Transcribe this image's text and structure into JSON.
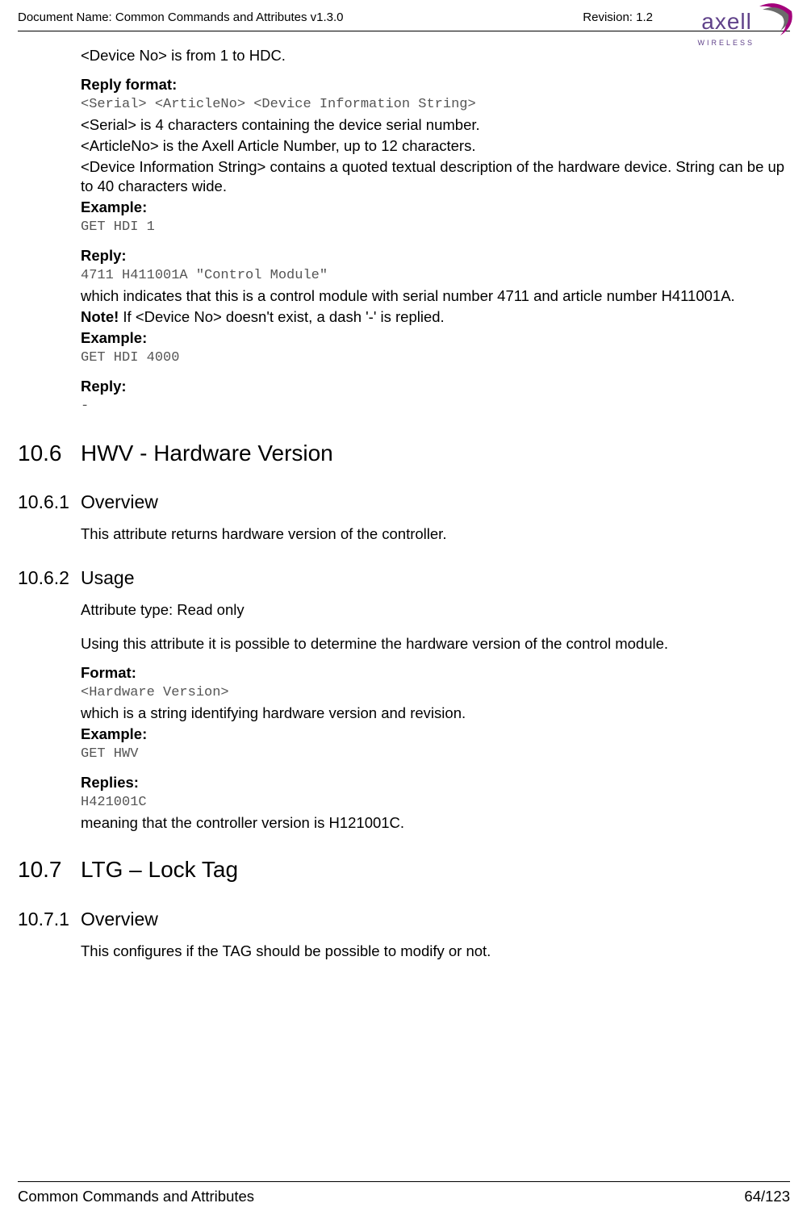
{
  "header": {
    "doc_name": "Document Name: Common Commands and Attributes v1.3.0",
    "revision": "Revision: 1.2",
    "logo_text": "axell",
    "logo_sub": "WIRELESS"
  },
  "intro": {
    "line1": "<Device No> is from 1 to HDC.",
    "reply_format_label": "Reply format:",
    "reply_format_code": "<Serial> <ArticleNo> <Device Information String>",
    "desc1": "<Serial> is 4 characters containing the device serial number.",
    "desc2": "<ArticleNo> is the Axell Article Number, up to 12 characters.",
    "desc3": "<Device Information String> contains a quoted textual description of the hardware device. String can be up to 40 characters wide.",
    "example_label": "Example:",
    "example_code": "GET HDI 1",
    "reply_label": "Reply:",
    "reply_code": "4711 H411001A \"Control Module\"",
    "reply_desc": "which indicates that this is a control module with serial number 4711 and article number H411001A.",
    "note": "Note! If <Device No> doesn't exist, a dash '-' is replied.",
    "note_prefix": "Note!",
    "note_rest": " If <Device No> doesn't exist, a dash '-' is replied.",
    "example2_label": "Example:",
    "example2_code": "GET HDI 4000",
    "reply2_label": "Reply:",
    "reply2_code": "-"
  },
  "s106": {
    "num": "10.6",
    "title": "HWV - Hardware Version"
  },
  "s1061": {
    "num": "10.6.1",
    "title": "Overview",
    "text": "This attribute returns hardware version of the controller."
  },
  "s1062": {
    "num": "10.6.2",
    "title": "Usage",
    "attr": "Attribute type: Read only",
    "desc": "Using this attribute it is possible to determine the hardware version of the control module.",
    "format_label": "Format:",
    "format_code": "<Hardware Version>",
    "format_desc": "which is a string identifying hardware version and revision.",
    "example_label": "Example:",
    "example_code": "GET HWV",
    "replies_label": "Replies:",
    "replies_code": "H421001C",
    "replies_desc": "meaning that the controller version is H121001C."
  },
  "s107": {
    "num": "10.7",
    "title": "LTG – Lock Tag"
  },
  "s1071": {
    "num": "10.7.1",
    "title": "Overview",
    "text": "This configures if the TAG should be possible to modify or not."
  },
  "footer": {
    "left": "Common Commands and Attributes",
    "right": "64/123"
  }
}
